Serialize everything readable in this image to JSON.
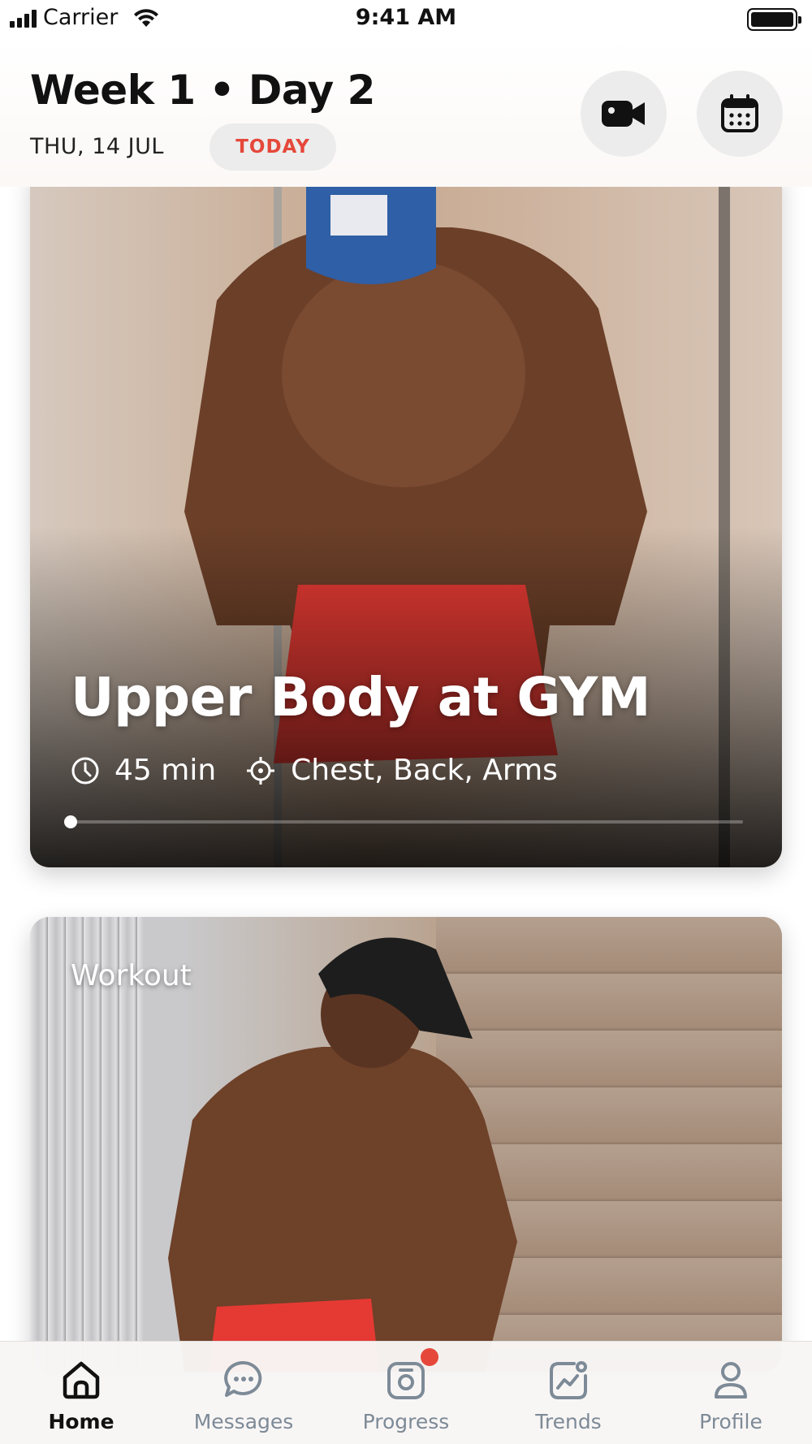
{
  "status_bar": {
    "carrier": "Carrier",
    "time": "9:41 AM",
    "battery_level": 1.0
  },
  "header": {
    "title": "Week 1 • Day 2",
    "date": "THU, 14 JUL",
    "today_label": "TODAY",
    "icons": [
      "video-camera-icon",
      "calendar-icon"
    ]
  },
  "cards": [
    {
      "title": "Upper Body at GYM",
      "duration": "45 min",
      "focus": "Chest, Back, Arms",
      "progress": 0.0,
      "icons": [
        "clock-icon",
        "target-icon"
      ]
    },
    {
      "label": "Workout"
    }
  ],
  "tabs": [
    {
      "label": "Home",
      "icon": "home-icon",
      "active": true
    },
    {
      "label": "Messages",
      "icon": "chat-icon",
      "active": false
    },
    {
      "label": "Progress",
      "icon": "camera-icon",
      "active": false,
      "badge": true
    },
    {
      "label": "Trends",
      "icon": "trends-icon",
      "active": false
    },
    {
      "label": "Profile",
      "icon": "profile-icon",
      "active": false
    }
  ],
  "colors": {
    "accent": "#e5483a",
    "tab_inactive": "#7d8a97",
    "pill_bg": "#ececec"
  }
}
